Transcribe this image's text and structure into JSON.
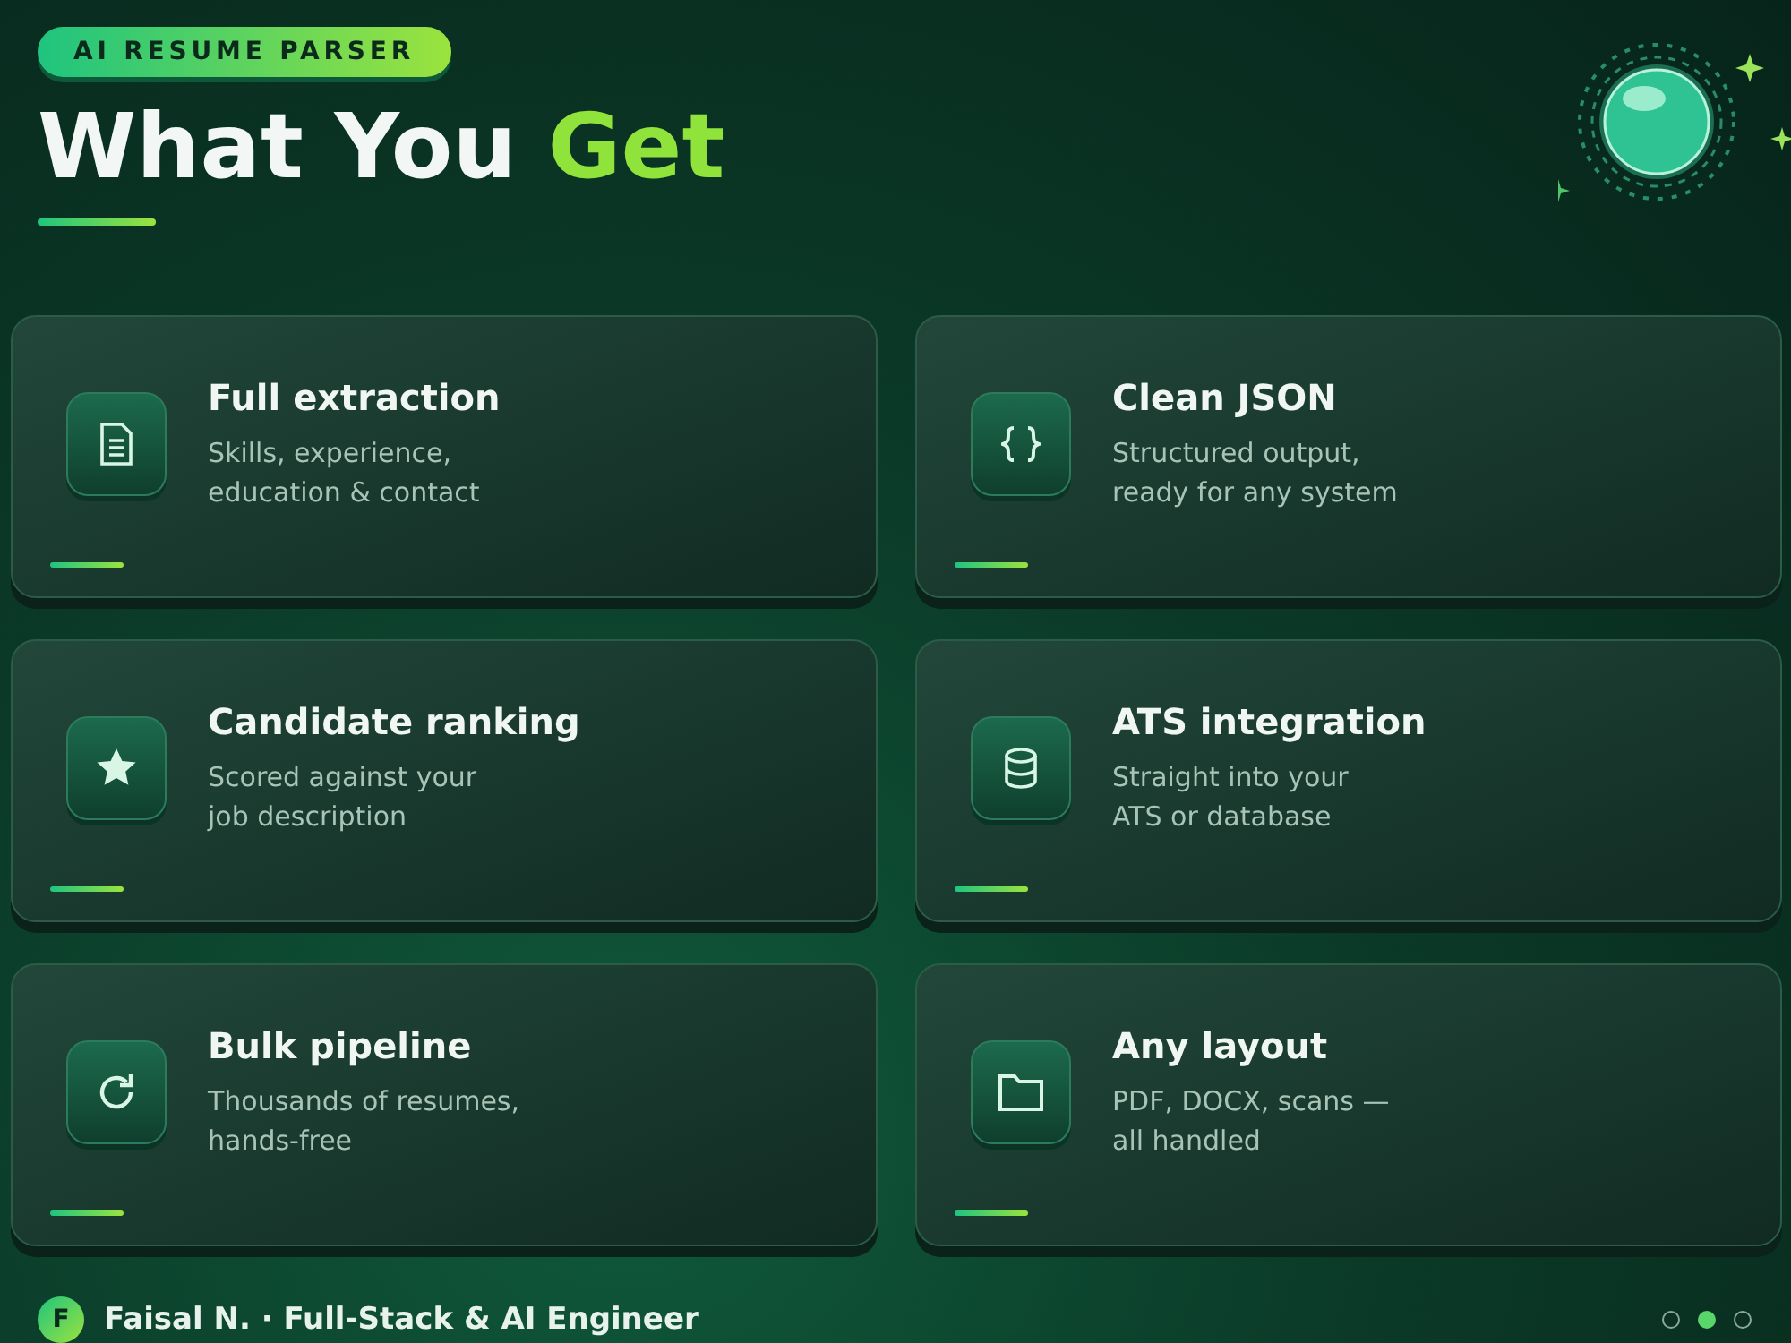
{
  "badge": "AI RESUME PARSER",
  "title": [
    {
      "text": "What You ",
      "accent": false
    },
    {
      "text": "Get",
      "accent": true
    }
  ],
  "cards": [
    {
      "title": "Full extraction",
      "description": "Skills, experience,\neducation & contact"
    },
    {
      "title": "Clean JSON",
      "description": "Structured output,\nready for any system"
    },
    {
      "title": "Candidate ranking",
      "description": "Scored against your\njob description"
    },
    {
      "title": "ATS integration",
      "description": "Straight into your\nATS or database"
    },
    {
      "title": "Bulk pipeline",
      "description": "Thousands of resumes,\nhands-free"
    },
    {
      "title": "Any layout",
      "description": "PDF, DOCX, scans —\nall handled"
    }
  ],
  "footer": {
    "avatar": "F",
    "author": "Faisal N. · Full-Stack & AI Engineer"
  },
  "pages": [
    {
      "selected": false
    },
    {
      "selected": true
    },
    {
      "selected": false
    }
  ]
}
